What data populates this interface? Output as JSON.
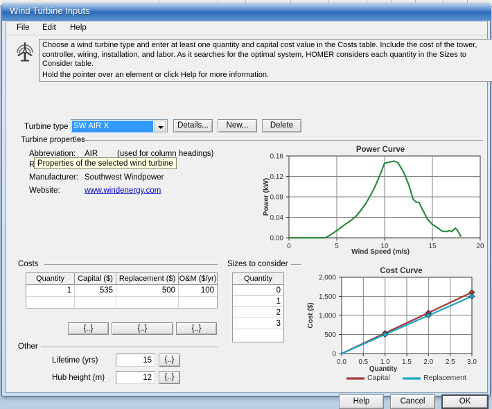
{
  "window": {
    "title": "Wind Turbine Inputs",
    "menu": [
      "File",
      "Edit",
      "Help"
    ]
  },
  "description": {
    "icon": "wind-turbine-icon",
    "paragraph1": "Choose a wind turbine type and enter at least one quantity and capital cost value in the Costs table. Include the cost of the tower, controller, wiring, installation, and labor. As it searches for the optimal system, HOMER considers each quantity in the Sizes to Consider table.",
    "paragraph2": "Hold the pointer over an element or click Help for more information."
  },
  "turbine_type": {
    "label": "Turbine type",
    "value": "SW AIR X",
    "buttons": [
      "Details...",
      "New...",
      "Delete"
    ]
  },
  "turbine_properties": {
    "group_title": "Turbine properties",
    "abbreviation_label": "Abbreviation:",
    "abbreviation_value": "AIR",
    "abbreviation_note": "(used for column headings)",
    "rated_power_label": "Rated power:",
    "manufacturer_label": "Manufacturer:",
    "manufacturer_value": "Southwest Windpower",
    "website_label": "Website:",
    "website_value": "www.windenergy.com"
  },
  "tooltip": {
    "text": "Properties of the selected wind turbine"
  },
  "costs": {
    "group_title": "Costs",
    "headers": [
      "Quantity",
      "Capital ($)",
      "Replacement ($)",
      "O&M ($/yr)"
    ],
    "rows": [
      [
        "1",
        "535",
        "500",
        "100"
      ],
      [
        "",
        "",
        "",
        ""
      ]
    ],
    "dot_buttons": [
      "{..}",
      "{..}",
      "{..}"
    ]
  },
  "sizes_to_consider": {
    "group_title": "Sizes to consider",
    "header": "Quantity",
    "values": [
      "0",
      "1",
      "2",
      "3",
      ""
    ]
  },
  "other": {
    "group_title": "Other",
    "fields": [
      {
        "label": "Lifetime (yrs)",
        "value": "15",
        "button": "{..}"
      },
      {
        "label": "Hub height (m)",
        "value": "12",
        "button": "{..}"
      }
    ]
  },
  "footer": {
    "help": "Help",
    "cancel": "Cancel",
    "ok": "OK"
  },
  "colors": {
    "capital": "#a63b3b",
    "replacement": "#17a8c8",
    "power_curve": "#2e8b3d",
    "titlebar": "#3b79c4",
    "selection": "#3399ff",
    "link": "#0000cc"
  },
  "chart_data": [
    {
      "type": "line",
      "title": "Power Curve",
      "xlabel": "Wind Speed (m/s)",
      "ylabel": "Power (kW)",
      "xlim": [
        0,
        20
      ],
      "ylim": [
        0.0,
        0.16
      ],
      "xticks": [
        "0",
        "5",
        "10",
        "15",
        "20"
      ],
      "yticks": [
        "0.00",
        "0.04",
        "0.08",
        "0.12",
        "0.16"
      ],
      "grid": true,
      "legend": "none",
      "series": [
        {
          "name": "Power",
          "color": "#2e8b3d",
          "x": [
            0,
            1,
            2,
            3,
            3.8,
            4.2,
            4.6,
            5.0,
            5.5,
            6.0,
            6.5,
            7.0,
            7.5,
            8.0,
            8.5,
            9.0,
            9.5,
            10.0,
            10.5,
            11.0,
            11.4,
            12.0,
            12.5,
            13.0,
            13.3,
            13.6,
            14.0,
            14.5,
            15.0,
            15.5,
            16.0,
            16.4,
            16.8,
            17.0,
            17.4,
            17.6,
            18.0
          ],
          "y": [
            0.0,
            0.0,
            0.0,
            0.0,
            0.0,
            0.004,
            0.009,
            0.014,
            0.021,
            0.028,
            0.034,
            0.042,
            0.053,
            0.066,
            0.082,
            0.1,
            0.122,
            0.146,
            0.148,
            0.15,
            0.147,
            0.128,
            0.105,
            0.075,
            0.07,
            0.069,
            0.054,
            0.036,
            0.026,
            0.02,
            0.013,
            0.012,
            0.014,
            0.012,
            0.019,
            0.015,
            0.002
          ]
        }
      ]
    },
    {
      "type": "line",
      "title": "Cost Curve",
      "xlabel": "Quantity",
      "ylabel": "Cost ($)",
      "xlim": [
        0,
        3
      ],
      "ylim": [
        0,
        2000
      ],
      "xticks": [
        "0.0",
        "0.5",
        "1.0",
        "1.5",
        "2.0",
        "2.5",
        "3.0"
      ],
      "yticks": [
        "0",
        "500",
        "1,000",
        "1,500",
        "2,000"
      ],
      "grid": true,
      "legend": "bottom",
      "series": [
        {
          "name": "Capital",
          "color": "#a63b3b",
          "x": [
            0,
            1,
            2,
            3
          ],
          "y": [
            0,
            535,
            1070,
            1605
          ],
          "markers": [
            1,
            2,
            3
          ]
        },
        {
          "name": "Replacement",
          "color": "#17a8c8",
          "x": [
            0,
            1,
            2,
            3
          ],
          "y": [
            0,
            500,
            1000,
            1500
          ],
          "markers": [
            1,
            2,
            3
          ]
        }
      ]
    }
  ]
}
